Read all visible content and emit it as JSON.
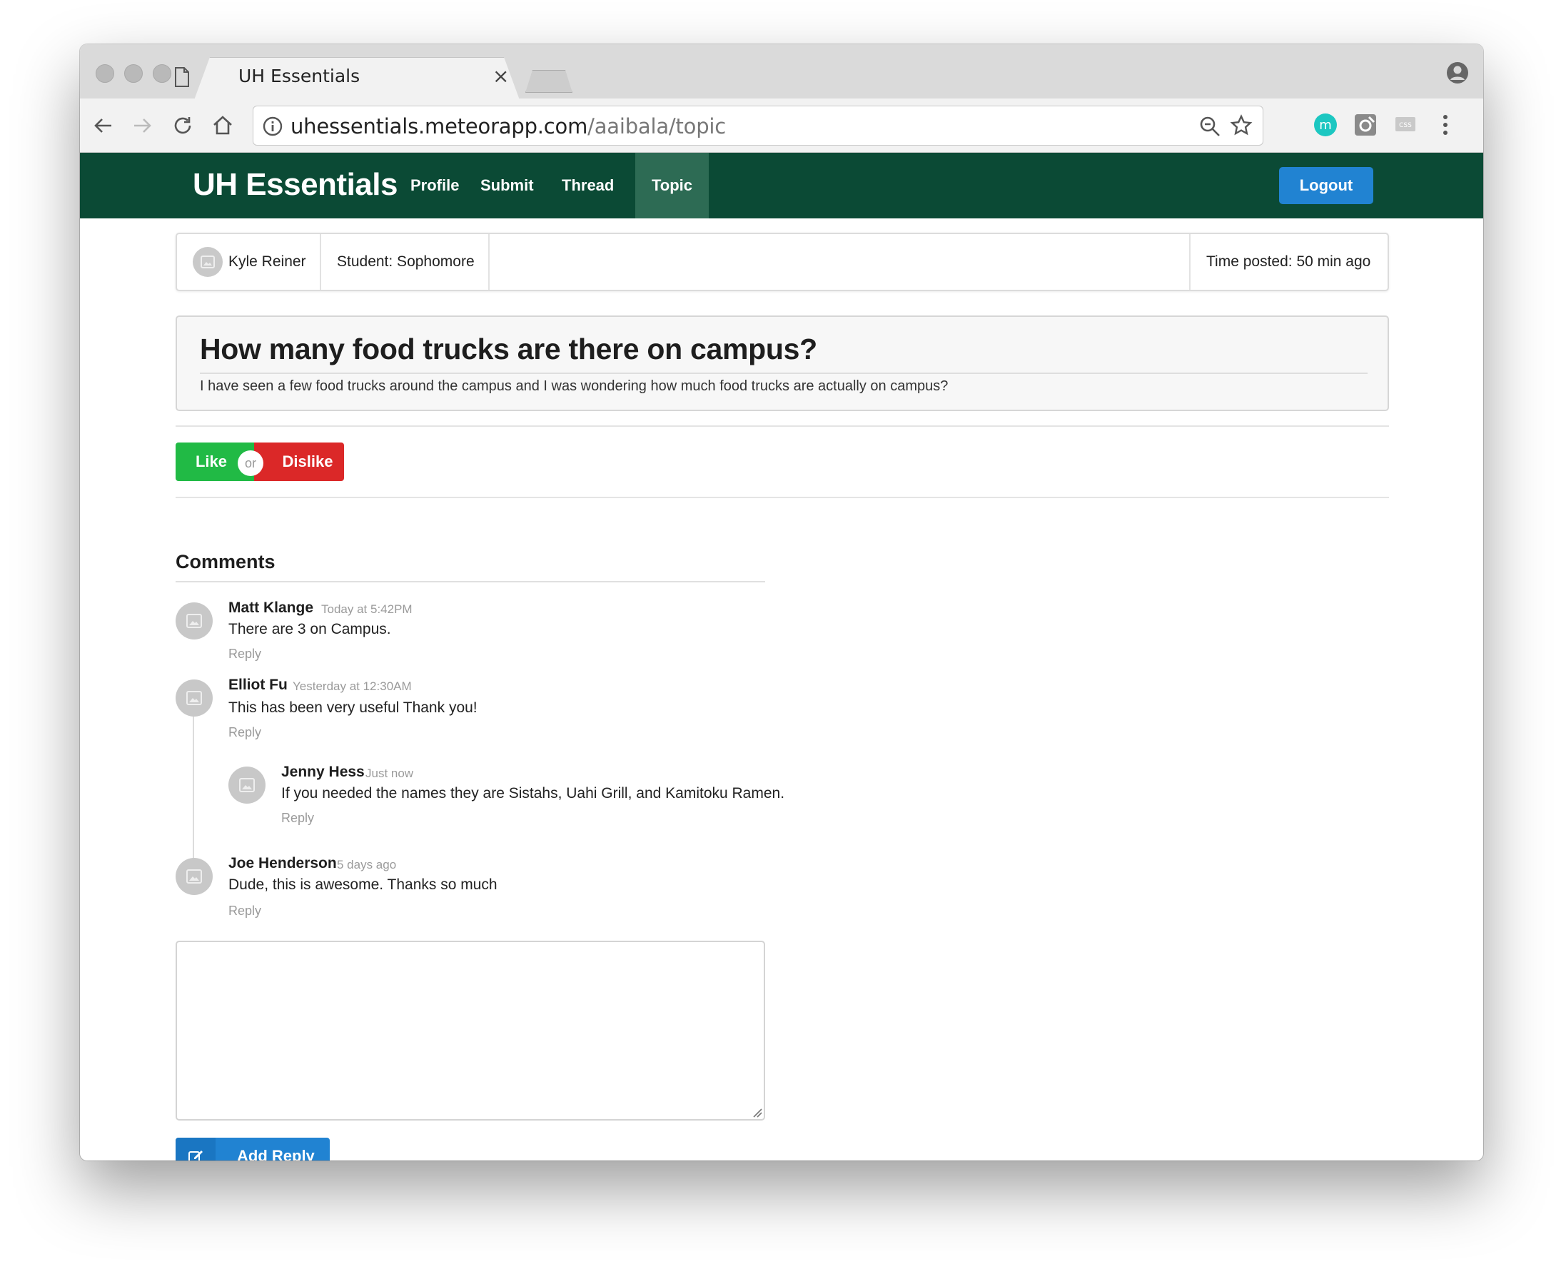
{
  "browser": {
    "tab_title": "UH Essentials",
    "tab_close": "×",
    "url_host": "uhessentials.meteorapp.com",
    "url_path": "/aaibala/topic",
    "extension_m_label": "m",
    "extension_css_label": "CSS"
  },
  "navbar": {
    "brand": "UH Essentials",
    "links": [
      "Profile",
      "Submit",
      "Thread",
      "Topic"
    ],
    "active": "Topic",
    "logout": "Logout"
  },
  "topic_meta": {
    "author": "Kyle Reiner",
    "role": "Student: Sophomore",
    "time_posted": "Time posted: 50 min ago"
  },
  "question": {
    "title": "How many food trucks are there on campus?",
    "body": "I have seen a few food trucks around the campus and I was wondering how much food trucks are actually on campus?"
  },
  "vote": {
    "like": "Like",
    "or": "or",
    "dislike": "Dislike"
  },
  "comments": {
    "heading": "Comments",
    "items": [
      {
        "author": "Matt Klange",
        "time": "Today at 5:42PM",
        "text": "There are 3 on Campus.",
        "reply": "Reply"
      },
      {
        "author": "Elliot Fu",
        "time": "Yesterday at 12:30AM",
        "text": "This has been very useful Thank you!",
        "reply": "Reply"
      },
      {
        "author": "Jenny Hess",
        "time": "Just now",
        "text": "If you needed the names they are Sistahs, Uahi Grill, and Kamitoku Ramen.",
        "reply": "Reply"
      },
      {
        "author": "Joe Henderson",
        "time": "5 days ago",
        "text": "Dude, this is awesome. Thanks so much",
        "reply": "Reply"
      }
    ]
  },
  "reply_form": {
    "textarea_value": "",
    "submit": "Add Reply"
  },
  "colors": {
    "navbar": "#0b4a35",
    "navbar_active": "#2d6b54",
    "primary": "#2183d2",
    "like": "#21ba45",
    "dislike": "#db2828"
  }
}
